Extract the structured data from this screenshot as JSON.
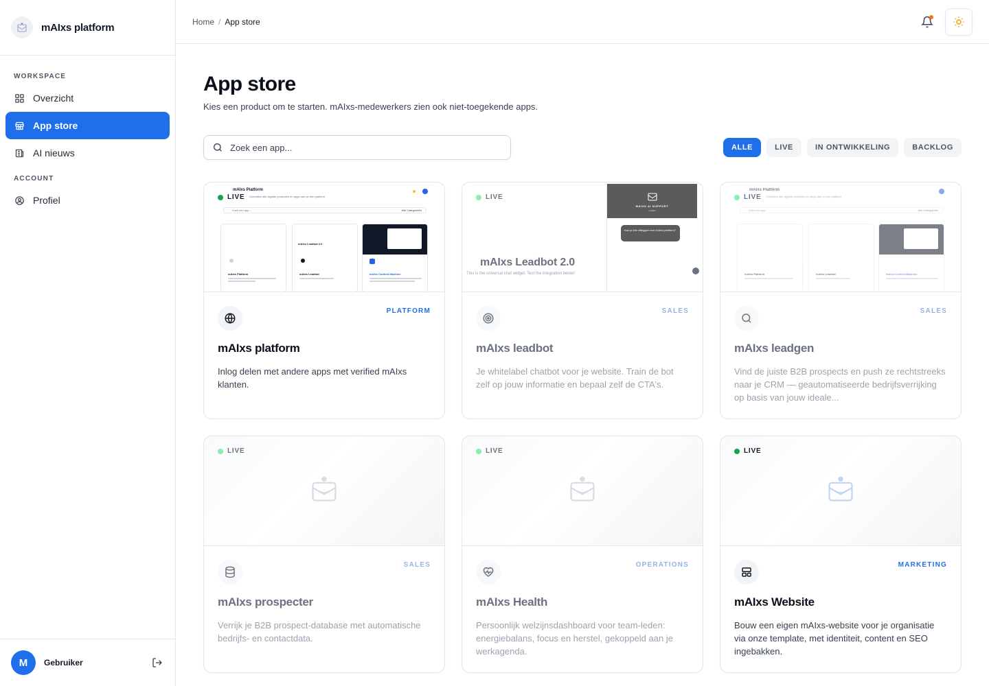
{
  "brand": {
    "name": "mAIxs platform"
  },
  "sidebar": {
    "sections": [
      {
        "label": "WORKSPACE",
        "items": [
          {
            "label": "Overzicht",
            "icon": "grid-icon",
            "active": false
          },
          {
            "label": "App store",
            "icon": "store-icon",
            "active": true
          },
          {
            "label": "AI nieuws",
            "icon": "newspaper-icon",
            "active": false
          }
        ]
      },
      {
        "label": "ACCOUNT",
        "items": [
          {
            "label": "Profiel",
            "icon": "user-circle-icon",
            "active": false
          }
        ]
      }
    ],
    "user": {
      "initial": "M",
      "name": "Gebruiker"
    }
  },
  "breadcrumb": {
    "home": "Home",
    "separator": "/",
    "current": "App store"
  },
  "page": {
    "title": "App store",
    "subtitle": "Kies een product om te starten. mAIxs-medewerkers zien ook niet-toegekende apps.",
    "search_placeholder": "Zoek een app..."
  },
  "filters": [
    {
      "label": "ALLE",
      "active": true
    },
    {
      "label": "LIVE",
      "active": false
    },
    {
      "label": "IN ONTWIKKELING",
      "active": false
    },
    {
      "label": "BACKLOG",
      "active": false
    }
  ],
  "apps": [
    {
      "status": "LIVE",
      "category": "PLATFORM",
      "name": "mAIxs platform",
      "description": "Inlog delen met andere apps met verified mAIxs klanten.",
      "icon": "globe-icon"
    },
    {
      "status": "LIVE",
      "category": "SALES",
      "name": "mAIxs leadbot",
      "description": "Je whitelabel chatbot voor je website. Train de bot zelf op jouw informatie en bepaal zelf de CTA's.",
      "icon": "target-icon"
    },
    {
      "status": "LIVE",
      "category": "SALES",
      "name": "mAIxs leadgen",
      "description": "Vind de juiste B2B prospects en push ze rechtstreeks naar je CRM — geautomatiseerde bedrijfsverrijking op basis van jouw ideale...",
      "icon": "search-icon"
    },
    {
      "status": "LIVE",
      "category": "SALES",
      "name": "mAIxs prospecter",
      "description": "Verrijk je B2B prospect-database met automatische bedrijfs- en contactdata.",
      "icon": "database-icon"
    },
    {
      "status": "LIVE",
      "category": "OPERATIONS",
      "name": "mAIxs Health",
      "description": "Persoonlijk welzijnsdashboard voor team-leden: energiebalans, focus en herstel, gekoppeld aan je werkagenda.",
      "icon": "heart-pulse-icon"
    },
    {
      "status": "LIVE",
      "category": "MARKETING",
      "name": "mAIxs Website",
      "description": "Bouw een eigen mAIxs-website voor je organisatie via onze template, met identiteit, content en SEO ingebakken.",
      "icon": "layout-icon"
    }
  ],
  "previews": {
    "platform": {
      "title": "mAIxs Platform",
      "subtitle": "Centralize alle digitale producten en apps aan op één platform",
      "search": "Zoek een app...",
      "filter": "Alle Categorieën",
      "cards": [
        "mAIxs Platform",
        "mAIxs Leadbot",
        "mAIxs Content Machine"
      ],
      "heading": "mAIxs Leadbot 2.0"
    },
    "leadbot": {
      "title": "mAIxs Leadbot 2.0",
      "subtitle": "This is the universal chat widget. Test the integration below!",
      "widget_title": "MAIXS AI SUPPORT",
      "widget_status": "• Online",
      "bubble": "Kan je iets uitleggen over mAIxs platform?"
    }
  },
  "colors": {
    "accent": "#1f6feb",
    "live": "#16a34a",
    "notification": "#f97316",
    "theme_icon": "#f59e0b"
  }
}
